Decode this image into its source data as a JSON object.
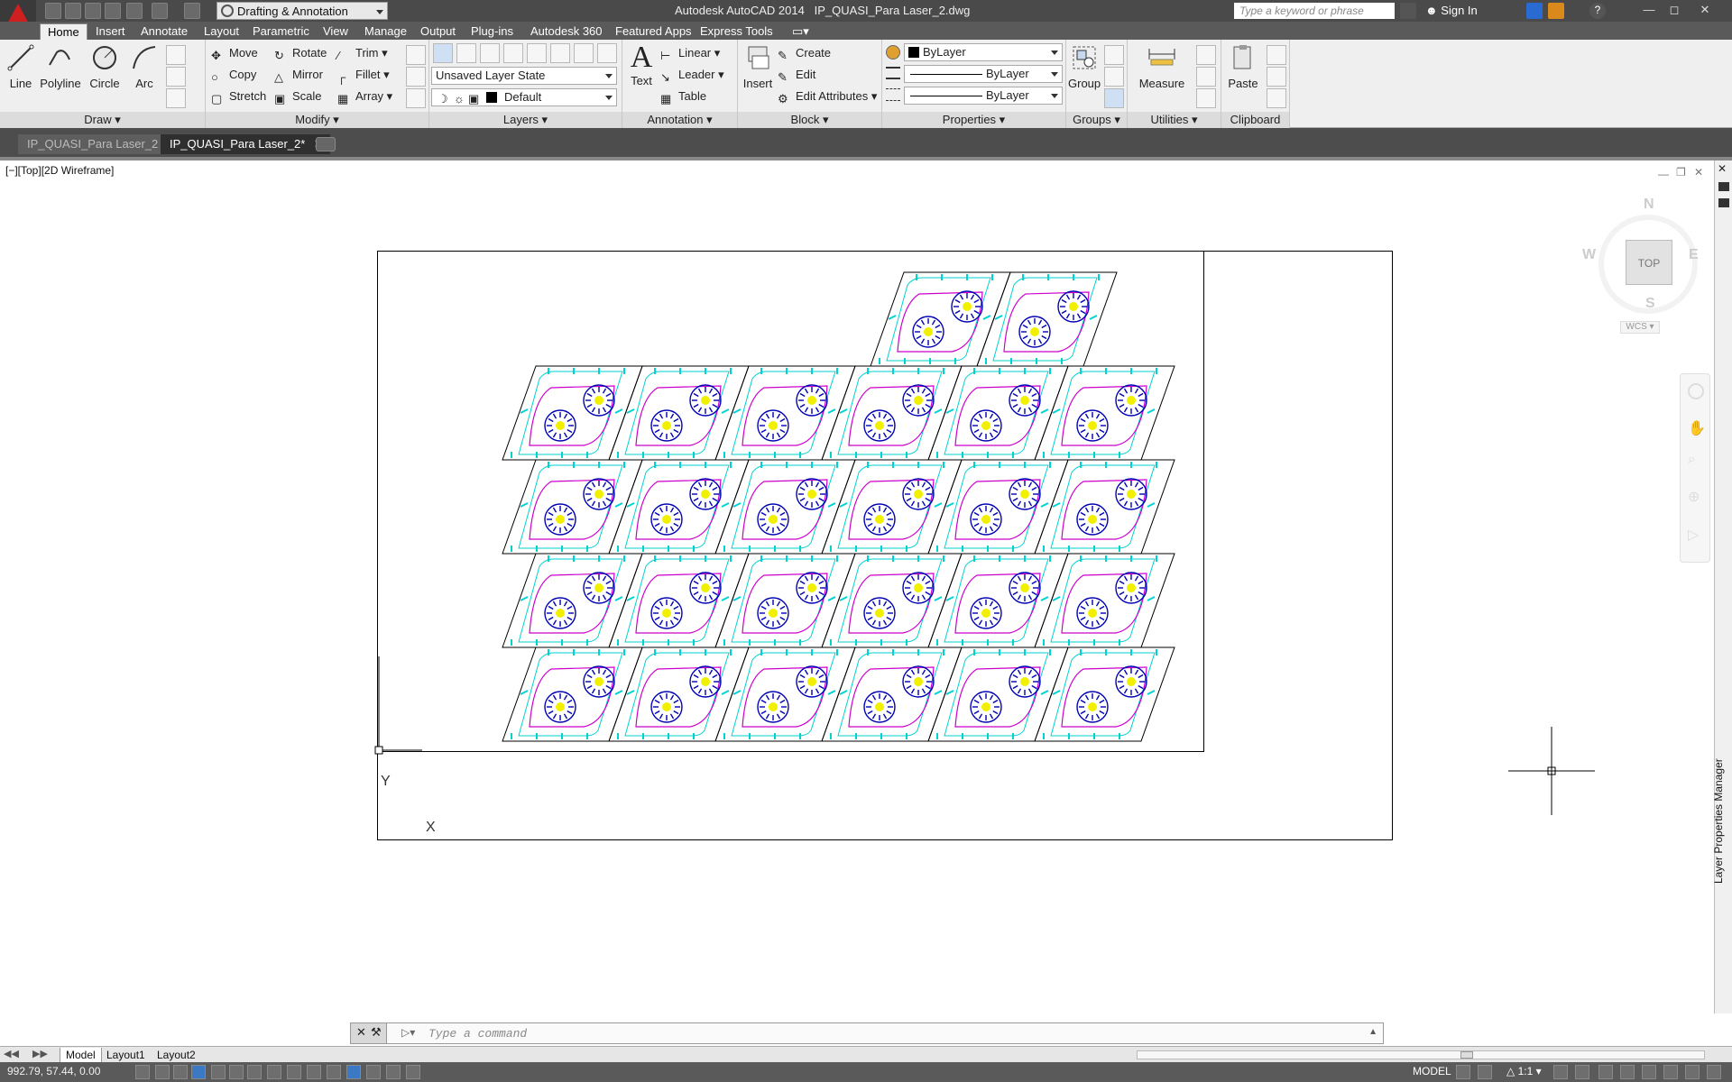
{
  "titlebar": {
    "workspace": "Drafting & Annotation",
    "app_title": "Autodesk AutoCAD 2014",
    "file_name": "IP_QUASI_Para Laser_2.dwg",
    "search_placeholder": "Type a keyword or phrase",
    "signin": "Sign In"
  },
  "ribbon_tabs": [
    "Home",
    "Insert",
    "Annotate",
    "Layout",
    "Parametric",
    "View",
    "Manage",
    "Output",
    "Plug-ins",
    "Autodesk 360",
    "Featured Apps",
    "Express Tools"
  ],
  "draw": {
    "title": "Draw",
    "line": "Line",
    "polyline": "Polyline",
    "circle": "Circle",
    "arc": "Arc"
  },
  "modify": {
    "title": "Modify",
    "move": "Move",
    "rotate": "Rotate",
    "trim": "Trim",
    "copy": "Copy",
    "mirror": "Mirror",
    "fillet": "Fillet",
    "stretch": "Stretch",
    "scale": "Scale",
    "array": "Array"
  },
  "layers": {
    "title": "Layers",
    "layer_state": "Unsaved Layer State",
    "current_layer": "Default"
  },
  "annotation": {
    "title": "Annotation",
    "text": "Text",
    "linear": "Linear",
    "leader": "Leader",
    "table": "Table"
  },
  "block": {
    "title": "Block",
    "insert": "Insert",
    "create": "Create",
    "edit": "Edit",
    "edit_attributes": "Edit Attributes"
  },
  "properties": {
    "title": "Properties",
    "color": "ByLayer",
    "linetype": "ByLayer",
    "lineweight": "ByLayer"
  },
  "groups": {
    "title": "Groups",
    "group": "Group"
  },
  "utilities": {
    "title": "Utilities",
    "measure": "Measure"
  },
  "clipboard": {
    "title": "Clipboard",
    "paste": "Paste"
  },
  "doc_tabs": [
    "IP_QUASI_Para Laser_2",
    "IP_QUASI_Para Laser_2*"
  ],
  "viewport": {
    "label": "[−][Top][2D Wireframe]"
  },
  "viewcube": {
    "top": "TOP",
    "north": "N",
    "south": "S",
    "east": "E",
    "west": "W",
    "wcs": "WCS"
  },
  "ucs": {
    "x": "X",
    "y": "Y"
  },
  "command": {
    "placeholder": "Type a command"
  },
  "layout_tabs": [
    "Model",
    "Layout1",
    "Layout2"
  ],
  "status": {
    "coords": "992.79, 57.44, 0.00",
    "model": "MODEL",
    "scale": "1:1"
  },
  "side_panel": {
    "label": "Layer Properties Manager"
  },
  "colors": {
    "outline": "#000000",
    "cyan": "#00d2d2",
    "magenta": "#cc00cc",
    "blue": "#0000b4",
    "yellow": "#f0f000"
  }
}
